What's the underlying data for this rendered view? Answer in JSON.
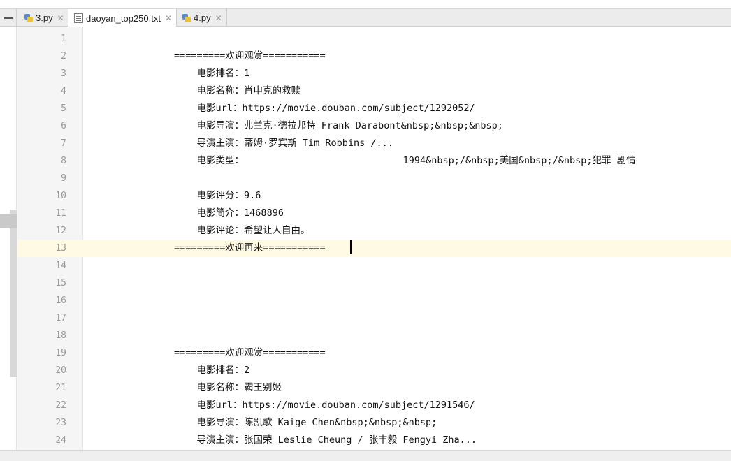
{
  "tabs": [
    {
      "label": "3.py",
      "icon": "python-file-icon",
      "active": false
    },
    {
      "label": "daoyan_top250.txt",
      "icon": "text-file-icon",
      "active": true
    },
    {
      "label": "4.py",
      "icon": "python-file-icon",
      "active": false
    }
  ],
  "tab_close_glyph": "✕",
  "current_line": 13,
  "lines": [
    {
      "num": "1",
      "text": ""
    },
    {
      "num": "2",
      "text": "                =========欢迎观赏==========="
    },
    {
      "num": "3",
      "text": "                    电影排名：1"
    },
    {
      "num": "4",
      "text": "                    电影名称：肖申克的救赎"
    },
    {
      "num": "5",
      "text": "                    电影url：https://movie.douban.com/subject/1292052/"
    },
    {
      "num": "6",
      "text": "                    电影导演：弗兰克·德拉邦特 Frank Darabont&nbsp;&nbsp;&nbsp;"
    },
    {
      "num": "7",
      "text": "                    导演主演：蒂姆·罗宾斯 Tim Robbins /..."
    },
    {
      "num": "8",
      "text": "                    电影类型：                            1994&nbsp;/&nbsp;美国&nbsp;/&nbsp;犯罪 剧情"
    },
    {
      "num": "9",
      "text": ""
    },
    {
      "num": "10",
      "text": "                    电影评分：9.6"
    },
    {
      "num": "11",
      "text": "                    电影简介：1468896"
    },
    {
      "num": "12",
      "text": "                    电影评论：希望让人自由。"
    },
    {
      "num": "13",
      "text": "                =========欢迎再来==========="
    },
    {
      "num": "14",
      "text": ""
    },
    {
      "num": "15",
      "text": ""
    },
    {
      "num": "16",
      "text": ""
    },
    {
      "num": "17",
      "text": ""
    },
    {
      "num": "18",
      "text": ""
    },
    {
      "num": "19",
      "text": "                =========欢迎观赏==========="
    },
    {
      "num": "20",
      "text": "                    电影排名：2"
    },
    {
      "num": "21",
      "text": "                    电影名称：霸王别姬"
    },
    {
      "num": "22",
      "text": "                    电影url：https://movie.douban.com/subject/1291546/"
    },
    {
      "num": "23",
      "text": "                    电影导演：陈凯歌 Kaige Chen&nbsp;&nbsp;&nbsp;"
    },
    {
      "num": "24",
      "text": "                    导演主演：张国荣 Leslie Cheung / 张丰毅 Fengyi Zha..."
    }
  ]
}
